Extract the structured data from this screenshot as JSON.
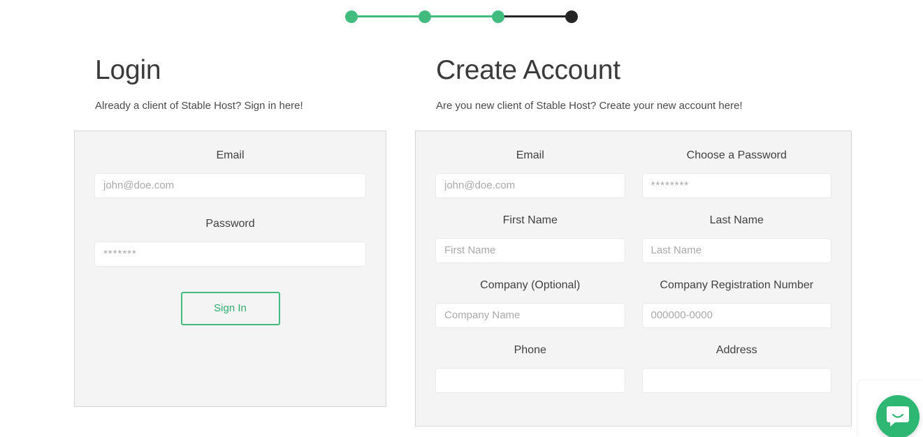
{
  "stepper": {
    "steps": [
      {
        "state": "done"
      },
      {
        "state": "done"
      },
      {
        "state": "done"
      },
      {
        "state": "current"
      }
    ],
    "colors": {
      "done": "#43bb7f",
      "current": "#252525"
    }
  },
  "login": {
    "title": "Login",
    "subtitle": "Already a client of Stable Host? Sign in here!",
    "email": {
      "label": "Email",
      "placeholder": "john@doe.com",
      "value": ""
    },
    "password": {
      "label": "Password",
      "placeholder": "*******",
      "value": ""
    },
    "submit_label": "Sign In"
  },
  "register": {
    "title": "Create Account",
    "subtitle": "Are you new client of Stable Host? Create your new account here!",
    "fields": [
      {
        "label": "Email",
        "placeholder": "john@doe.com",
        "value": ""
      },
      {
        "label": "Choose a Password",
        "placeholder": "********",
        "value": ""
      },
      {
        "label": "First Name",
        "placeholder": "First Name",
        "value": ""
      },
      {
        "label": "Last Name",
        "placeholder": "Last Name",
        "value": ""
      },
      {
        "label": "Company (Optional)",
        "placeholder": "Company Name",
        "value": ""
      },
      {
        "label": "Company Registration Number",
        "placeholder": "000000-0000",
        "value": ""
      },
      {
        "label": "Phone",
        "placeholder": "",
        "value": ""
      },
      {
        "label": "Address",
        "placeholder": "",
        "value": ""
      }
    ]
  },
  "chat_launcher": {
    "icon": "chat-smile-icon",
    "color": "#2eb673"
  }
}
